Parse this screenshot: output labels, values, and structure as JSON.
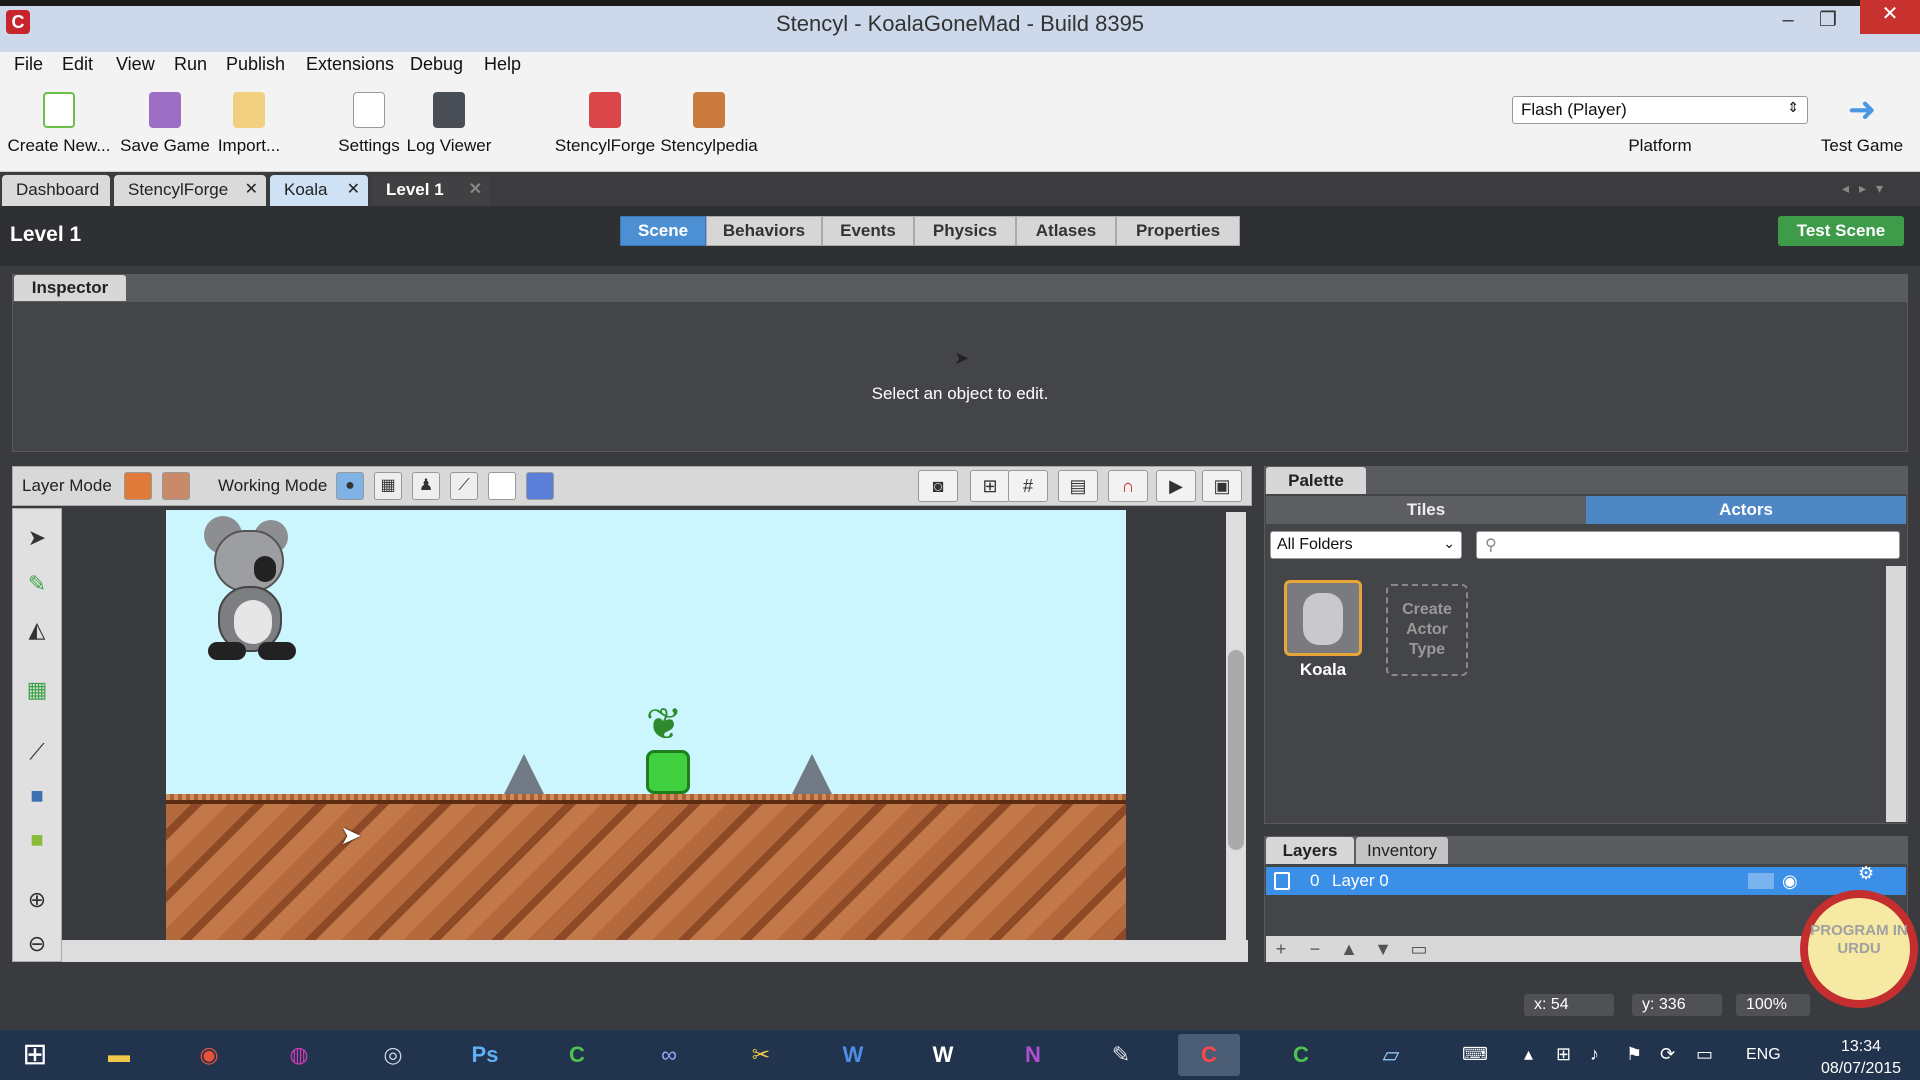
{
  "window": {
    "title": "Stencyl - KoalaGoneMad - Build 8395",
    "icon_letter": "C"
  },
  "menu": [
    "File",
    "Edit",
    "View",
    "Run",
    "Publish",
    "Extensions",
    "Debug",
    "Help"
  ],
  "toolbar": {
    "create_new": "Create New...",
    "save_game": "Save Game",
    "import": "Import...",
    "settings": "Settings",
    "log_viewer": "Log Viewer",
    "stencylforge": "StencylForge",
    "stencylpedia": "Stencylpedia",
    "platform_value": "Flash (Player)",
    "platform_label": "Platform",
    "test_game": "Test Game"
  },
  "doc_tabs": [
    "Dashboard",
    "StencylForge",
    "Koala",
    "Level 1"
  ],
  "scene": {
    "title": "Level 1",
    "tabs": [
      "Scene",
      "Behaviors",
      "Events",
      "Physics",
      "Atlases",
      "Properties"
    ],
    "test_scene": "Test Scene"
  },
  "inspector": {
    "tab": "Inspector",
    "message": "Select an object to edit."
  },
  "editor": {
    "layer_mode": "Layer Mode",
    "working_mode": "Working Mode"
  },
  "palette": {
    "tab": "Palette",
    "tiles": "Tiles",
    "actors": "Actors",
    "folder": "All Folders",
    "search_placeholder": "",
    "actor_name": "Koala",
    "create_actor": "Create Actor Type"
  },
  "layers": {
    "tab_layers": "Layers",
    "tab_inventory": "Inventory",
    "row_index": "0",
    "row_name": "Layer 0"
  },
  "status": {
    "x": "x:  54",
    "y": "y:  336",
    "zoom": "100%"
  },
  "badge": "PROGRAM IN URDU",
  "taskbar": {
    "lang": "ENG",
    "time": "13:34",
    "date": "08/07/2015"
  },
  "colors": {
    "accent": "#4d8fd3",
    "test_scene": "#3e9b4a",
    "selected_layer": "#3b8fe6",
    "actor_highlight": "#e8a53a"
  }
}
